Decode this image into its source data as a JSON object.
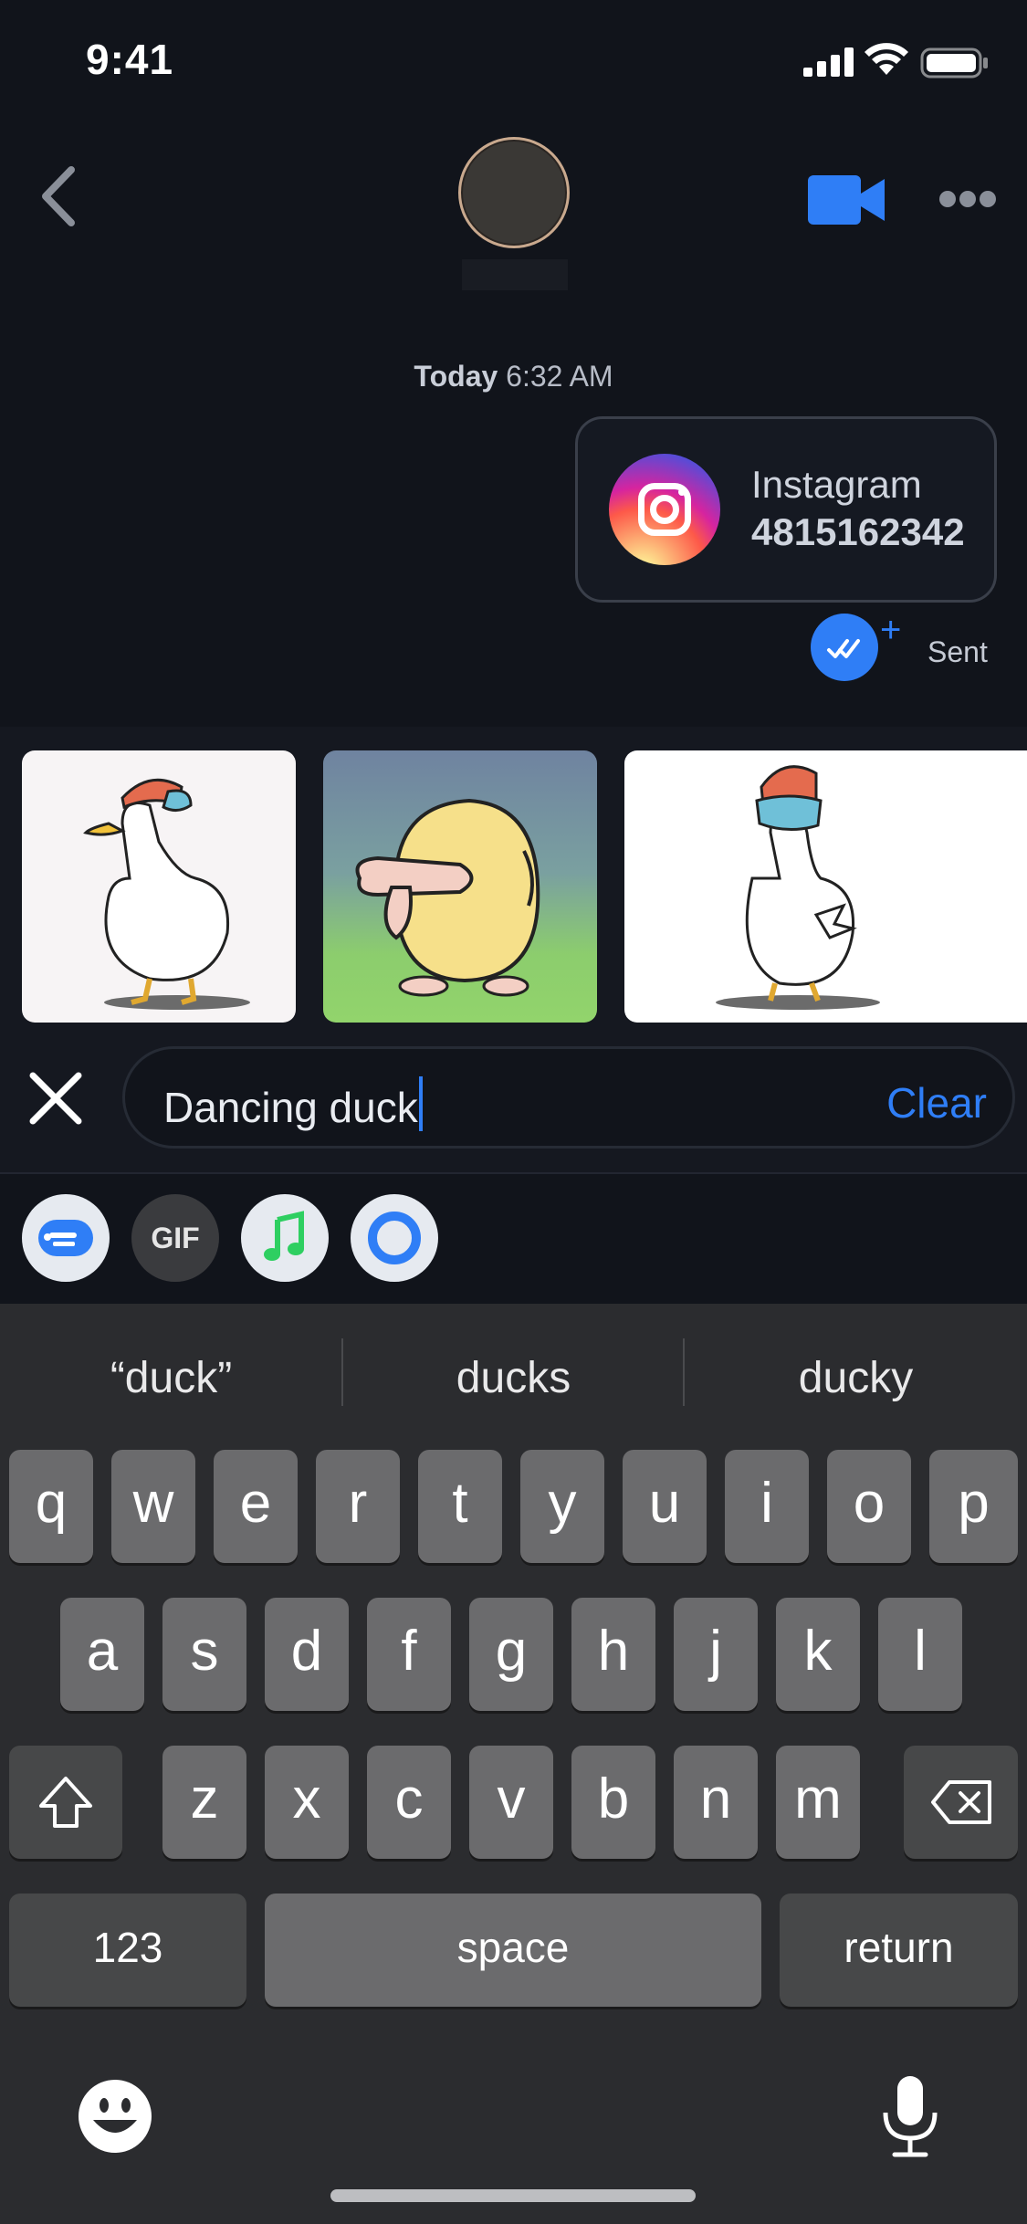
{
  "status_bar": {
    "time": "9:41"
  },
  "chat": {
    "timestamp_day": "Today",
    "timestamp_time": "6:32 AM",
    "card": {
      "title": "Instagram",
      "number": "4815162342"
    },
    "sent_label": "Sent"
  },
  "search": {
    "value": "Dancing duck",
    "clear_label": "Clear"
  },
  "tools": {
    "gif_label": "GIF"
  },
  "keyboard": {
    "suggestions": [
      "“duck”",
      "ducks",
      "ducky"
    ],
    "row1": [
      "q",
      "w",
      "e",
      "r",
      "t",
      "y",
      "u",
      "i",
      "o",
      "p"
    ],
    "row2": [
      "a",
      "s",
      "d",
      "f",
      "g",
      "h",
      "j",
      "k",
      "l"
    ],
    "row3": [
      "z",
      "x",
      "c",
      "v",
      "b",
      "n",
      "m"
    ],
    "numbers_label": "123",
    "space_label": "space",
    "return_label": "return"
  },
  "colors": {
    "accent": "#2f7ef6",
    "background": "#11141b",
    "keyboard": "#2b2c2f"
  }
}
